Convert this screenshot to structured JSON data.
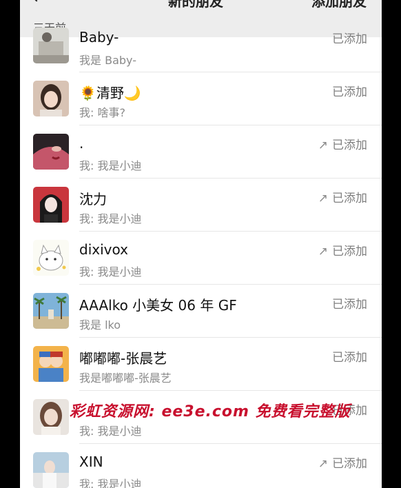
{
  "header": {
    "title": "新的朋友",
    "right_action": "添加朋友"
  },
  "section_label": "三天前",
  "contacts": [
    {
      "name": "Baby-",
      "message": "我是 Baby-",
      "status": "已添加",
      "outgoing": false
    },
    {
      "name": "🌻清野🌙",
      "message": "我: 啥事?",
      "status": "已添加",
      "outgoing": false
    },
    {
      "name": ".",
      "message": "我: 我是小迪",
      "status": "已添加",
      "outgoing": true
    },
    {
      "name": "沈力",
      "message": "我: 我是小迪",
      "status": "已添加",
      "outgoing": true
    },
    {
      "name": "dixivox",
      "message": "我: 我是小迪",
      "status": "已添加",
      "outgoing": true
    },
    {
      "name": "AAAlko 小美女 06 年 GF",
      "message": "我是 lko",
      "status": "已添加",
      "outgoing": false
    },
    {
      "name": "嘟嘟嘟-张晨艺",
      "message": "我是嘟嘟嘟-张晨艺",
      "status": "已添加",
      "outgoing": false
    },
    {
      "name": "",
      "message": "我: 我是小迪",
      "status": "已添加",
      "outgoing": false
    },
    {
      "name": "XIN",
      "message": "我: 我是小迪",
      "status": "已添加",
      "outgoing": true
    }
  ],
  "arrow_glyph": "↗",
  "watermark": "彩虹资源网: ee3e.com 免费看完整版",
  "colors": {
    "background": "#ededed",
    "status_text": "#7f7f7f",
    "watermark": "#c8102e"
  }
}
